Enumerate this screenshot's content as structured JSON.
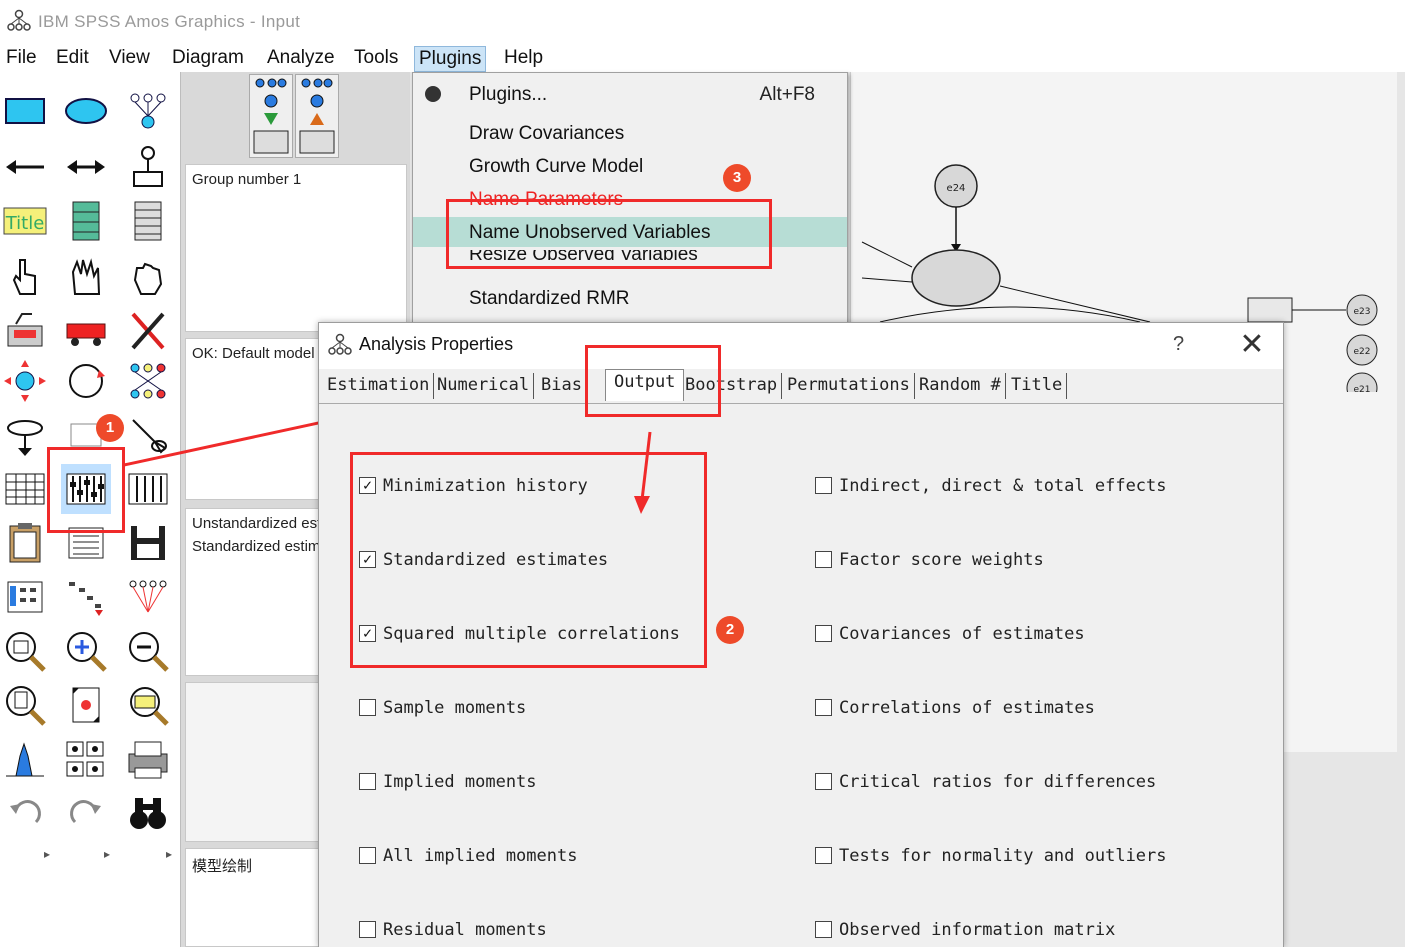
{
  "window": {
    "title": "IBM SPSS Amos Graphics - Input"
  },
  "menubar": {
    "items": [
      "File",
      "Edit",
      "View",
      "Diagram",
      "Analyze",
      "Tools",
      "Plugins",
      "Help"
    ],
    "active": "Plugins"
  },
  "plugins_menu": {
    "items": [
      {
        "label": "Plugins...",
        "shortcut": "Alt+F8"
      },
      {
        "label": "Draw Covariances",
        "shortcut": ""
      },
      {
        "label": "Growth Curve Model",
        "shortcut": ""
      },
      {
        "label": "Name Parameters",
        "shortcut": ""
      },
      {
        "label": "Name Unobserved Variables",
        "shortcut": ""
      },
      {
        "label": "Resize Observed Variables",
        "shortcut": ""
      },
      {
        "label": "Standardized RMR",
        "shortcut": ""
      }
    ],
    "highlighted": "Name Unobserved Variables"
  },
  "mid_panel": {
    "group_label": "Group number 1",
    "model_label": "OK: Default model",
    "estimates": [
      "Unstandardized estimates",
      "Standardized estimates"
    ],
    "bottom_label": "模型绘制"
  },
  "diagram": {
    "nodes": [
      "e24",
      "e23",
      "e22",
      "e21"
    ]
  },
  "dialog": {
    "title": "Analysis Properties",
    "help_label": "?",
    "close_label": "✕",
    "tabs": [
      "Estimation",
      "Numerical",
      "Bias",
      "Output",
      "Bootstrap",
      "Permutations",
      "Random #",
      "Title"
    ],
    "active_tab": "Output",
    "options_left": [
      {
        "label": "Minimization history",
        "checked": true
      },
      {
        "label": "Standardized estimates",
        "checked": true
      },
      {
        "label": "Squared multiple correlations",
        "checked": true
      },
      {
        "label": "Sample moments",
        "checked": false
      },
      {
        "label": "Implied moments",
        "checked": false
      },
      {
        "label": "All implied moments",
        "checked": false
      },
      {
        "label": "Residual moments",
        "checked": false
      }
    ],
    "options_right": [
      {
        "label": "Indirect, direct & total effects",
        "checked": false
      },
      {
        "label": "Factor score weights",
        "checked": false
      },
      {
        "label": "Covariances of estimates",
        "checked": false
      },
      {
        "label": "Correlations of estimates",
        "checked": false
      },
      {
        "label": "Critical ratios for differences",
        "checked": false
      },
      {
        "label": "Tests for normality and outliers",
        "checked": false
      },
      {
        "label": "Observed information matrix",
        "checked": false
      }
    ]
  },
  "annotations": {
    "badge_1": "1",
    "badge_2": "2",
    "badge_3": "3",
    "color": "#f02a2a"
  }
}
